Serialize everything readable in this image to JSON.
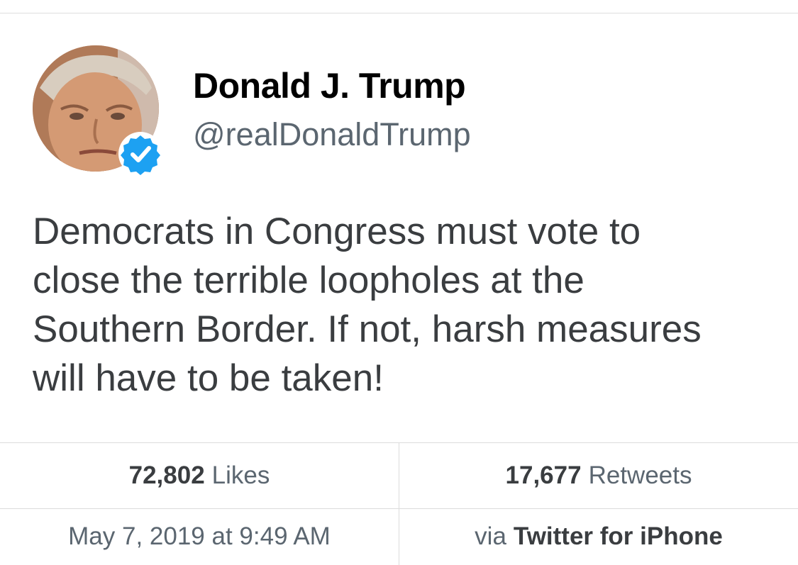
{
  "author": {
    "display_name": "Donald J. Trump",
    "handle": "@realDonaldTrump",
    "verified": true,
    "avatar_icon": "profile-photo",
    "verified_icon": "verified-badge-icon"
  },
  "tweet": {
    "lines": [
      "Democrats in Congress must vote to",
      "close the terrible loopholes at the",
      "Southern Border. If not, harsh measures",
      "will have to be taken!"
    ]
  },
  "stats": {
    "likes_count": "72,802",
    "likes_label": "Likes",
    "retweets_count": "17,677",
    "retweets_label": "Retweets"
  },
  "meta": {
    "timestamp": "May 7, 2019 at 9:49 AM",
    "via_label": "via",
    "source": "Twitter for iPhone"
  },
  "colors": {
    "verified_blue": "#1da1f2",
    "text_primary": "#000000",
    "text_secondary": "#5b6670",
    "divider": "#dcdcdc"
  }
}
